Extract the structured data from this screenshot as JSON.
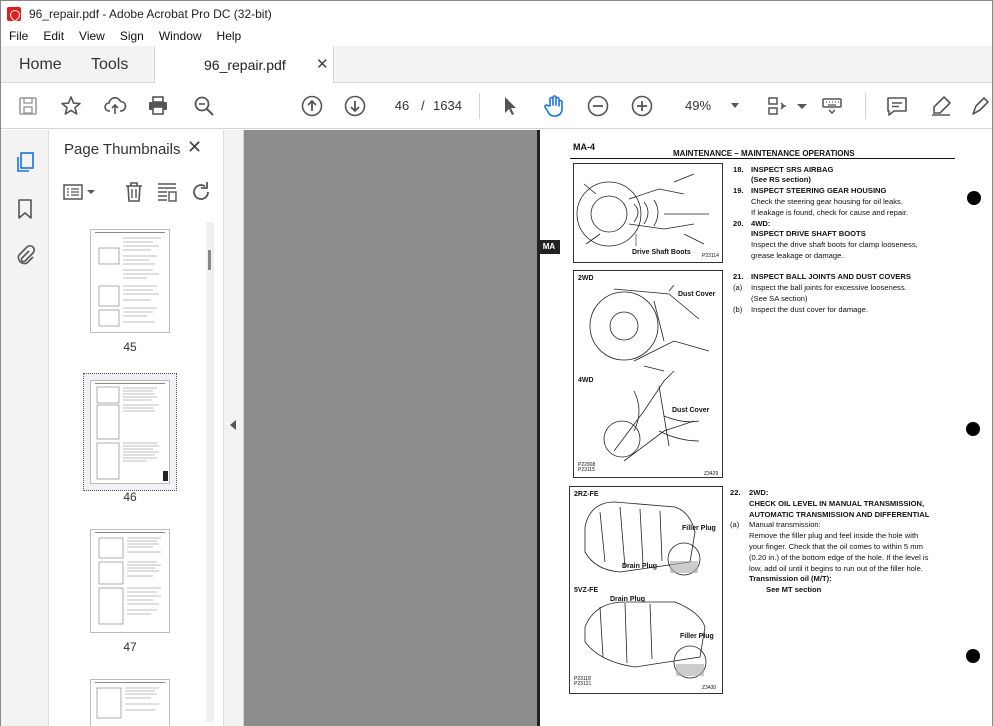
{
  "window": {
    "title": "96_repair.pdf - Adobe Acrobat Pro DC (32-bit)"
  },
  "menu": [
    "File",
    "Edit",
    "View",
    "Sign",
    "Window",
    "Help"
  ],
  "tabs": {
    "home": "Home",
    "tools": "Tools",
    "document": "96_repair.pdf",
    "close_glyph": "✕"
  },
  "toolbar": {
    "current_page": "46",
    "separator": "/",
    "total_pages": "1634",
    "zoom": "49%"
  },
  "thumbnails_panel": {
    "title": "Page Thumbnails",
    "close_glyph": "✕",
    "pages": [
      {
        "label": "45"
      },
      {
        "label": "46",
        "selected": true
      },
      {
        "label": "47"
      }
    ]
  },
  "page": {
    "page_id": "MA-4",
    "header": "MAINTENANCE – MAINTENANCE OPERATIONS",
    "side_tab": "MA",
    "figures": [
      {
        "labels": [
          "Drive Shaft Boots"
        ],
        "code": "P23114"
      },
      {
        "labels": [
          "2WD",
          "Dust Cover",
          "4WD",
          "Dust Cover"
        ],
        "code": "P22908\nP23115",
        "code2": "Z3429"
      },
      {
        "labels": [
          "2RZ-FE",
          "Filler Plug",
          "Drain Plug",
          "5VZ-FE",
          "Drain Plug",
          "Filler Plug"
        ],
        "code": "P23118\nP23121",
        "code2": "Z3430"
      }
    ],
    "items": [
      {
        "n": "18.",
        "title": "INSPECT SRS AIRBAG",
        "lines": [
          "(See RS section)"
        ]
      },
      {
        "n": "19.",
        "title": "INSPECT STEERING GEAR HOUSING",
        "lines": [
          "Check the steering gear housing for oil leaks.",
          "If leakage is found, check for cause and repair."
        ]
      },
      {
        "n": "20.",
        "title": "4WD:",
        "title2": "INSPECT DRIVE SHAFT BOOTS",
        "lines": [
          "Inspect the drive shaft boots for clamp looseness,",
          "grease leakage or damage."
        ]
      },
      {
        "n": "21.",
        "title": "INSPECT BALL JOINTS AND DUST COVERS",
        "sub": [
          {
            "k": "(a)",
            "t": "Inspect the ball joints for excessive looseness."
          },
          {
            "k": "",
            "t": "(See SA section)"
          },
          {
            "k": "(b)",
            "t": "Inspect the dust cover for damage."
          }
        ]
      },
      {
        "n": "22.",
        "title": "2WD:",
        "title2": "CHECK OIL LEVEL IN MANUAL TRANSMISSION,",
        "title3": "AUTOMATIC TRANSMISSION AND DIFFERENTIAL",
        "sub": [
          {
            "k": "(a)",
            "t": "Manual transmission:"
          }
        ],
        "lines": [
          "Remove the filler plug and feel inside the hole with",
          "your finger. Check that the oil comes to within 5 mm",
          "(0.20 in.) of the bottom edge of the hole. If the level is",
          "low, add oil until it begins to run out of the filler hole."
        ],
        "oil_title": "Transmission oil (M/T):",
        "oil_ref": "See MT section"
      }
    ]
  }
}
